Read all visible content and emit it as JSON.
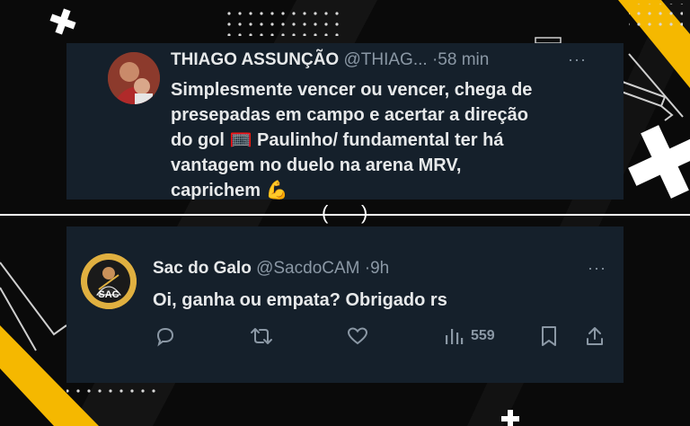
{
  "colors": {
    "card_bg": "#15202b",
    "accent_yellow": "#f5b800",
    "text": "#e7e9ea",
    "muted": "#8b98a5"
  },
  "tweet1": {
    "name": "THIAGO ASSUNÇÃO",
    "handle": "@THIAG...",
    "separator": "·",
    "time": "58 min",
    "more": "···",
    "lines": [
      "Simplesmente vencer ou vencer, chega de",
      "presepadas em campo e acertar a direção",
      "do gol 🥅 Paulinho/ fundamental ter há",
      "vantagem no duelo na arena MRV,",
      "caprichem 💪"
    ]
  },
  "tweet2": {
    "name": "Sac do Galo",
    "handle": "@SacdoCAM",
    "separator": "·",
    "time": "9h",
    "more": "···",
    "text": "Oi, ganha ou empata? Obrigado rs",
    "avatar_text": "SAC",
    "actions": {
      "reply_icon": "reply-icon",
      "retweet_icon": "retweet-icon",
      "like_icon": "heart-icon",
      "views_icon": "views-icon",
      "views_count": "559",
      "bookmark_icon": "bookmark-icon",
      "share_icon": "share-icon"
    }
  },
  "divider": {
    "left_paren": "(",
    "right_paren": ")"
  }
}
